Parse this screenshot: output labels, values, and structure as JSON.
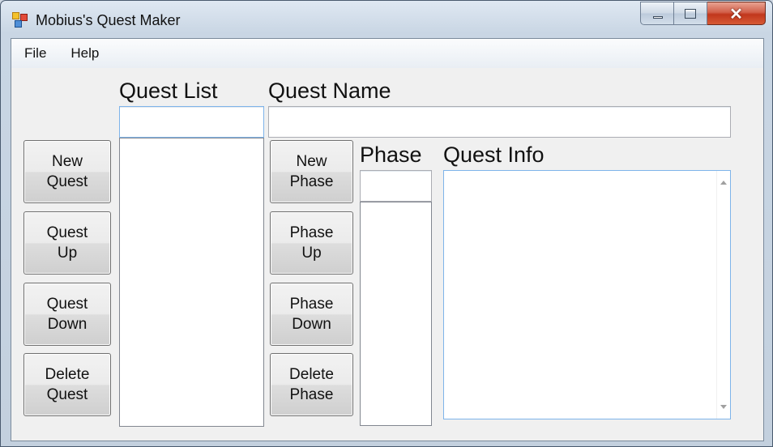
{
  "window": {
    "title": "Mobius's Quest Maker",
    "icon": "app-icon",
    "caption_buttons": [
      "minimize-icon",
      "maximize-icon",
      "close-icon"
    ],
    "close_glyph": "✕"
  },
  "menu": {
    "items": [
      "File",
      "Help"
    ]
  },
  "labels": {
    "quest_list": "Quest List",
    "quest_name": "Quest Name",
    "phase": "Phase",
    "quest_info": "Quest Info"
  },
  "inputs": {
    "quest_list_filter": "",
    "quest_name": "",
    "phase": ""
  },
  "buttons": {
    "new_quest": [
      "New",
      "Quest"
    ],
    "quest_up": [
      "Quest",
      "Up"
    ],
    "quest_down": [
      "Quest",
      "Down"
    ],
    "delete_quest": [
      "Delete",
      "Quest"
    ],
    "new_phase": [
      "New",
      "Phase"
    ],
    "phase_up": [
      "Phase",
      "Up"
    ],
    "phase_down": [
      "Phase",
      "Down"
    ],
    "delete_phase": [
      "Delete",
      "Phase"
    ]
  },
  "lists": {
    "quests": [],
    "phases": []
  },
  "quest_info_text": ""
}
